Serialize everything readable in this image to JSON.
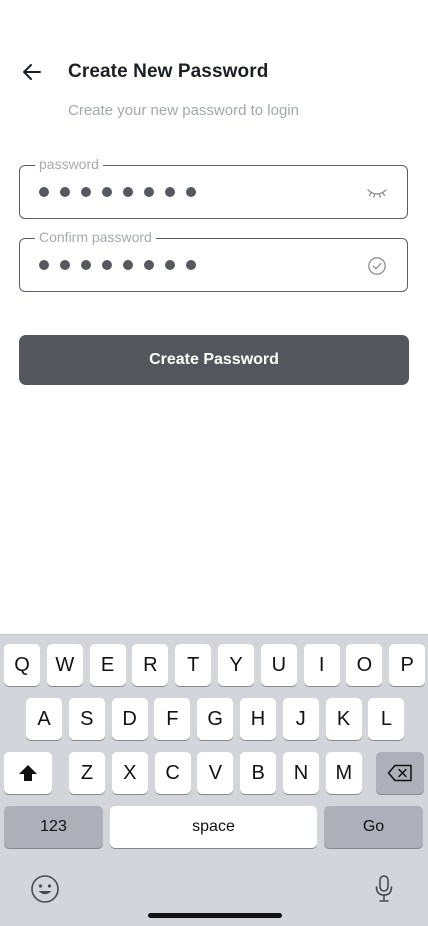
{
  "header": {
    "title": "Create New Password",
    "subtitle": "Create your new password to login",
    "back_icon": "arrow-left-icon"
  },
  "form": {
    "password": {
      "label": "password",
      "masked_length": 8,
      "icon": "eye-closed-icon"
    },
    "confirm_password": {
      "label": "Confirm password",
      "masked_length": 8,
      "icon": "check-circle-icon"
    },
    "submit_label": "Create Password"
  },
  "keyboard": {
    "row1": [
      "Q",
      "W",
      "E",
      "R",
      "T",
      "Y",
      "U",
      "I",
      "O",
      "P"
    ],
    "row2": [
      "A",
      "S",
      "D",
      "F",
      "G",
      "H",
      "J",
      "K",
      "L"
    ],
    "row3": [
      "Z",
      "X",
      "C",
      "V",
      "B",
      "N",
      "M"
    ],
    "shift_icon": "shift-icon",
    "delete_icon": "backspace-icon",
    "numbers_label": "123",
    "space_label": "space",
    "go_label": "Go",
    "emoji_icon": "emoji-icon",
    "mic_icon": "microphone-icon"
  },
  "colors": {
    "button_bg": "#53565c",
    "title": "#1c1f26",
    "muted": "#a3a7ad",
    "keyboard_bg": "#d3d5db"
  }
}
